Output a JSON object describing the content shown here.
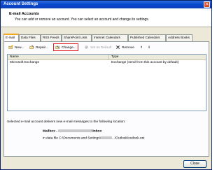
{
  "window": {
    "title": "Account Settings",
    "close_glyph": "✕"
  },
  "header": {
    "title": "E-mail Accounts",
    "description": "You can add or remove an account. You can select an account and change its settings."
  },
  "tabs": [
    {
      "label": "E-mail",
      "active": true
    },
    {
      "label": "Data Files"
    },
    {
      "label": "RSS Feeds"
    },
    {
      "label": "SharePoint Lists"
    },
    {
      "label": "Internet Calendars"
    },
    {
      "label": "Published Calendars"
    },
    {
      "label": "Address Books"
    }
  ],
  "toolbar": {
    "new_label": "New...",
    "repair_label": "Repair...",
    "change_label": "Change...",
    "set_default_label": "Set as Default",
    "remove_label": "Remove",
    "up_glyph": "⬆",
    "down_glyph": "⬇"
  },
  "table": {
    "headers": {
      "name": "Name",
      "type": "Type"
    },
    "rows": [
      {
        "name": "Microsoft Exchange",
        "type": "Exchange (send from this account by default)"
      }
    ]
  },
  "delivery": {
    "text": "Selected e-mail account delivers new e-mail messages to the following location:",
    "mailbox_prefix": "Mailbox -",
    "mailbox_suffix": "\\Inbox",
    "datafile_prefix": "in data file C:\\Documents and Settings\\",
    "datafile_suffix": "...\\Outlook\\outlook.ost"
  },
  "footer": {
    "close_label": "Close"
  },
  "colors": {
    "titlebar": "#0b4ad0",
    "highlight": "#e02020",
    "active_tab": "#f5a623"
  }
}
